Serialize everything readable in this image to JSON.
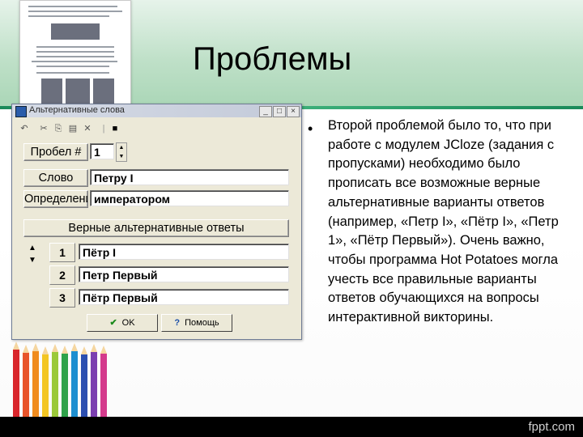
{
  "slide": {
    "title": "Проблемы",
    "bullet_symbol": "•",
    "bullet_text": "Второй проблемой было то, что при работе с модулем JCloze (задания с пропусками) необходимо было прописать все возможные верные альтернативные варианты ответов (например, «Петр I», «Пётр I», «Петр 1», «Пётр Первый»). Очень важно, чтобы программа Hot Potatoes могла учесть все правильные варианты ответов обучающихся на вопросы интерактивной викторины.",
    "footer": "fppt.com"
  },
  "dialog": {
    "title": "Альтернативные слова",
    "controls": {
      "minimize": "_",
      "maximize": "□",
      "close": "×"
    },
    "toolbar": [
      "undo-icon",
      "cut-icon",
      "copy-icon",
      "paste-icon",
      "delete-icon",
      "separator",
      "keyboard-icon"
    ],
    "gap_label": "Пробел #",
    "gap_value": "1",
    "word_label": "Слово",
    "word_value": "Петру I",
    "definition_label": "Определени",
    "definition_value": "императором",
    "alternatives_header": "Верные альтернативные ответы",
    "alternatives": [
      {
        "num": "1",
        "value": "Пётр I"
      },
      {
        "num": "2",
        "value": "Петр Первый"
      },
      {
        "num": "3",
        "value": "Пётр Первый"
      }
    ],
    "ok_label": "OK",
    "help_label": "Помощь"
  }
}
